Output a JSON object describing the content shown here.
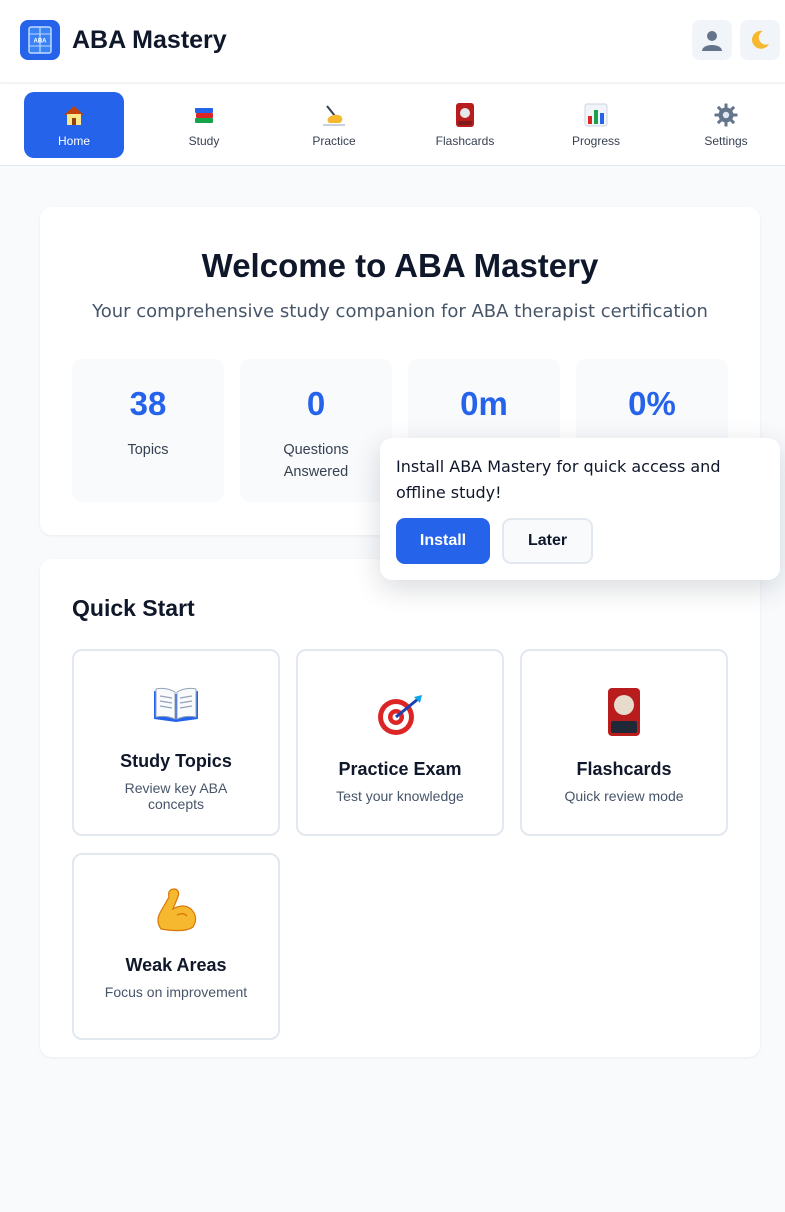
{
  "app": {
    "title": "ABA Mastery",
    "logo_text": "ABA",
    "icons": {
      "logo": "book-logo-icon",
      "user": "user-silhouette-icon",
      "theme": "crescent-moon-icon"
    }
  },
  "nav": {
    "items": [
      {
        "label": "Home",
        "icon": "house-icon",
        "active": true
      },
      {
        "label": "Study",
        "icon": "books-icon",
        "active": false
      },
      {
        "label": "Practice",
        "icon": "writing-hand-icon",
        "active": false
      },
      {
        "label": "Flashcards",
        "icon": "flashcard-icon",
        "active": false
      },
      {
        "label": "Progress",
        "icon": "bar-chart-icon",
        "active": false
      },
      {
        "label": "Settings",
        "icon": "gear-icon",
        "active": false
      }
    ]
  },
  "welcome": {
    "title": "Welcome to ABA Mastery",
    "subtitle": "Your comprehensive study companion for ABA therapist certification",
    "stats": [
      {
        "value": "38",
        "label": "Topics"
      },
      {
        "value": "0",
        "label": "Questions Answered"
      },
      {
        "value": "0m",
        "label": ""
      },
      {
        "value": "0%",
        "label": ""
      }
    ]
  },
  "quick_start": {
    "title": "Quick Start",
    "cards": [
      {
        "title": "Study Topics",
        "description": "Review key ABA concepts",
        "icon": "open-book-icon"
      },
      {
        "title": "Practice Exam",
        "description": "Test your knowledge",
        "icon": "target-icon"
      },
      {
        "title": "Flashcards",
        "description": "Quick review mode",
        "icon": "flashcard-icon"
      },
      {
        "title": "Weak Areas",
        "description": "Focus on improvement",
        "icon": "flexed-biceps-icon"
      }
    ]
  },
  "install_prompt": {
    "message": "Install ABA Mastery for quick access and offline study!",
    "install_label": "Install",
    "later_label": "Later"
  },
  "colors": {
    "primary": "#2563eb",
    "background": "#f8fafc",
    "card": "#ffffff",
    "text": "#0f172a",
    "muted": "#475569",
    "border": "#e2e8f0"
  }
}
